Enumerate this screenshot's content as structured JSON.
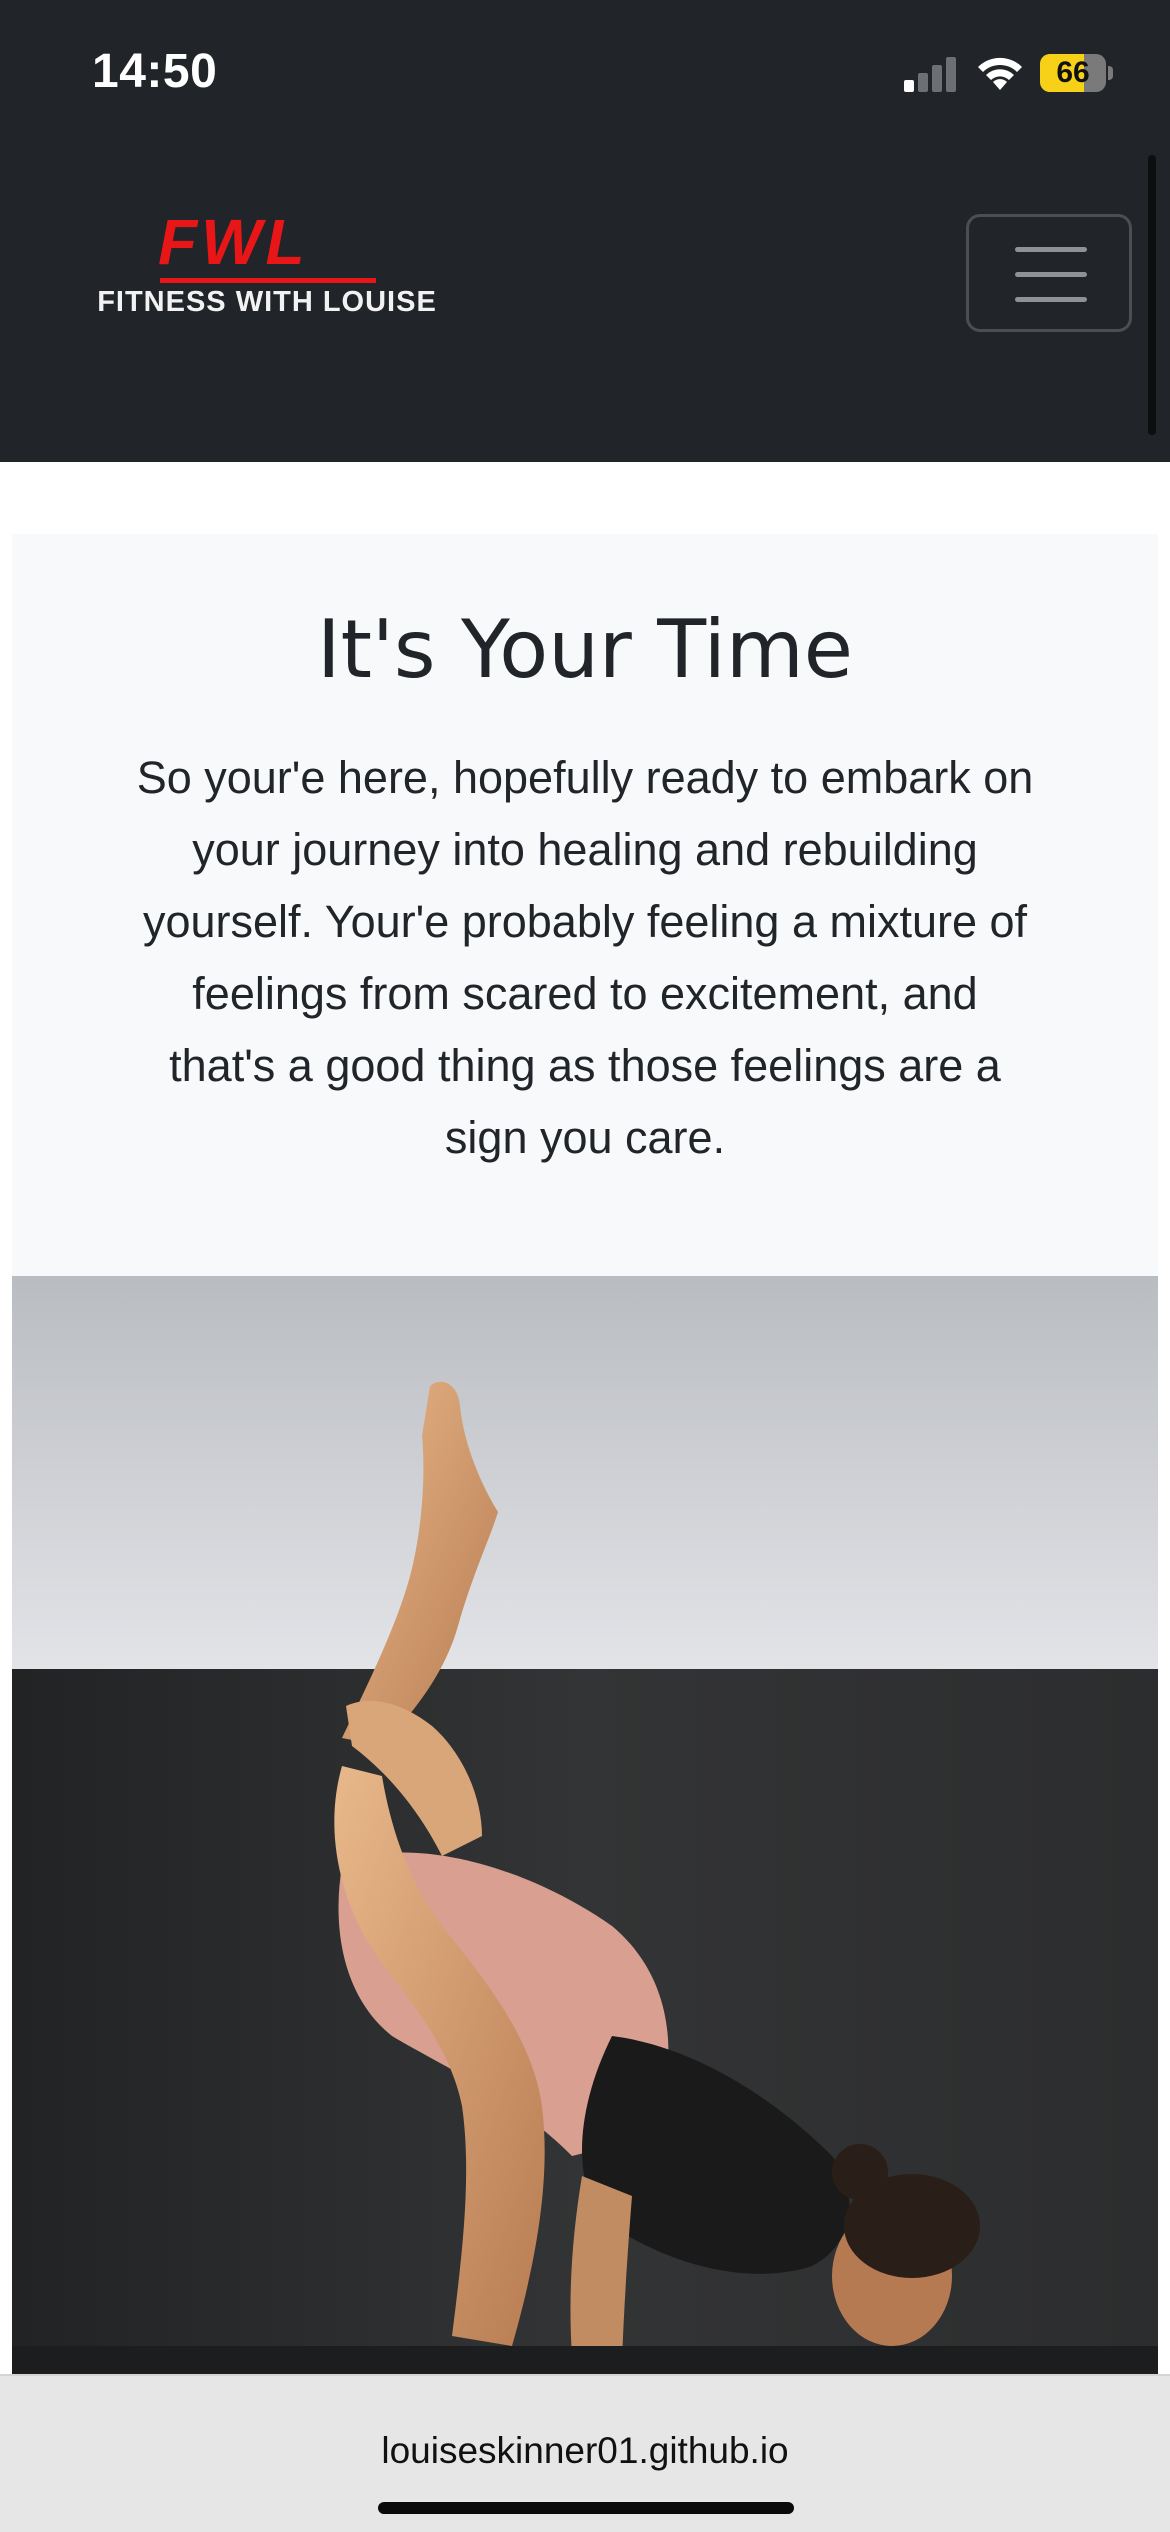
{
  "status_bar": {
    "time": "14:50",
    "battery": "66",
    "battery_level": 0.66,
    "battery_color": "#f7d117"
  },
  "navbar": {
    "brand_mark": "FWL",
    "brand_name": "FITNESS WITH LOUISE",
    "brand_color": "#e81616",
    "menu_icon": "hamburger-icon"
  },
  "hero": {
    "title": "It's Your Time",
    "body_lines": [
      "So your'e here, hopefully ready to embark on",
      "your journey into healing and rebuilding",
      "yourself. Your'e probably feeling a mixture of",
      "feelings from scared to excitement, and",
      "that's a good thing as those feelings are a",
      "sign you care."
    ]
  },
  "photo": {
    "subject": "yoga-pose-photo"
  },
  "browser": {
    "url": "louiseskinner01.github.io"
  },
  "colors": {
    "header_bg": "#212529",
    "hero_bg": "#f8f9fa",
    "text": "#212529"
  }
}
